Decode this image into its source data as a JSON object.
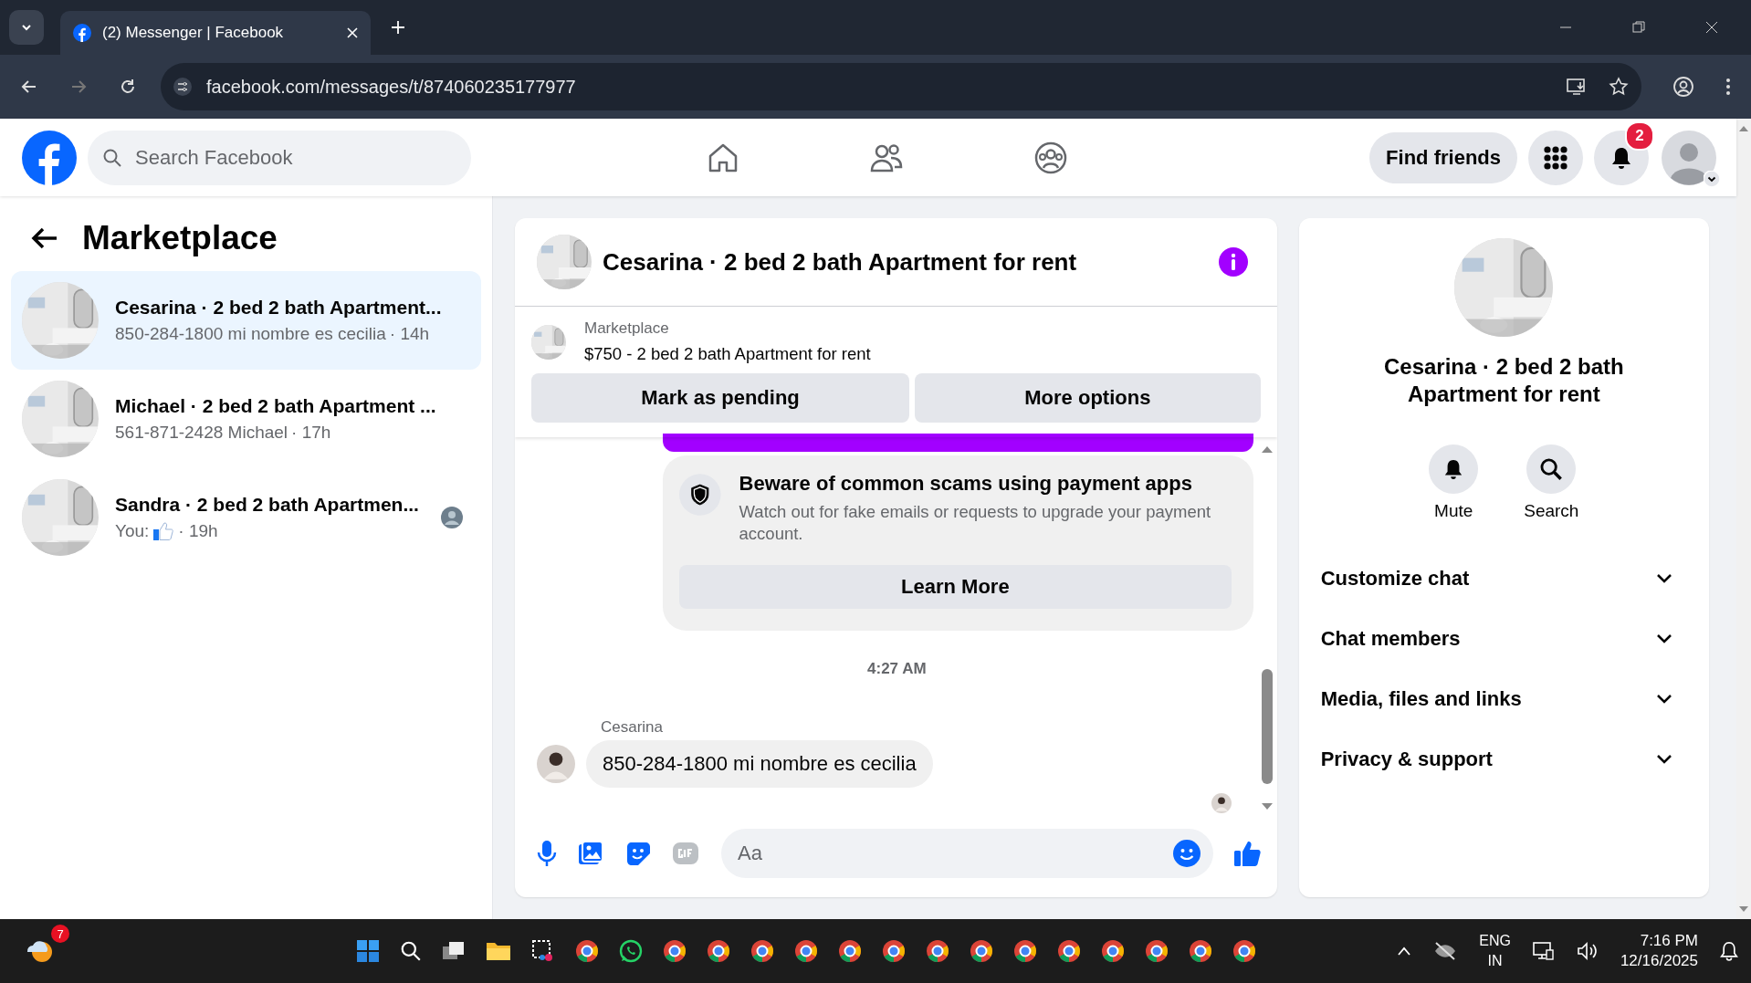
{
  "browser": {
    "tab": {
      "title": "(2) Messenger | Facebook"
    },
    "url": "facebook.com/messages/t/874060235177977"
  },
  "header": {
    "search": {
      "placeholder": "Search Facebook"
    },
    "find_friends": "Find friends",
    "notification_count": "2"
  },
  "sidebar": {
    "title": "Marketplace",
    "chats": [
      {
        "title": "Cesarina · 2 bed 2 bath Apartment...",
        "preview": "850-284-1800 mi nombre es cecilia",
        "time": "· 14h",
        "selected": true,
        "seen": false
      },
      {
        "title": "Michael · 2 bed 2 bath Apartment ...",
        "preview": "561-871-2428 Michael",
        "time": "· 17h",
        "selected": false,
        "seen": false
      },
      {
        "title": "Sandra · 2 bed 2 bath Apartmen...",
        "preview": "You:",
        "like": true,
        "time": "· 19h",
        "selected": false,
        "seen": true
      }
    ]
  },
  "chat": {
    "title": "Cesarina · 2 bed 2 bath Apartment for rent",
    "listing": {
      "source": "Marketplace",
      "name": "$750 - 2 bed 2 bath Apartment for rent",
      "buttons": [
        "Mark as pending",
        "More options"
      ]
    },
    "notice": {
      "title": "Beware of common scams using payment apps",
      "text": "Watch out for fake emails or requests to upgrade your payment account.",
      "button": "Learn More"
    },
    "timestamp": "4:27 AM",
    "message": {
      "sender": "Cesarina",
      "text": "850-284-1800  mi nombre es cecilia"
    },
    "composer": {
      "placeholder": "Aa"
    }
  },
  "details": {
    "title": "Cesarina · 2 bed 2 bath Apartment for rent",
    "actions": [
      "Mute",
      "Search"
    ],
    "sections": [
      "Customize chat",
      "Chat members",
      "Media, files and links",
      "Privacy & support"
    ]
  },
  "taskbar": {
    "weather_badge": "7",
    "language": "ENG",
    "region": "IN",
    "time": "7:16 PM",
    "date": "12/16/2025"
  }
}
